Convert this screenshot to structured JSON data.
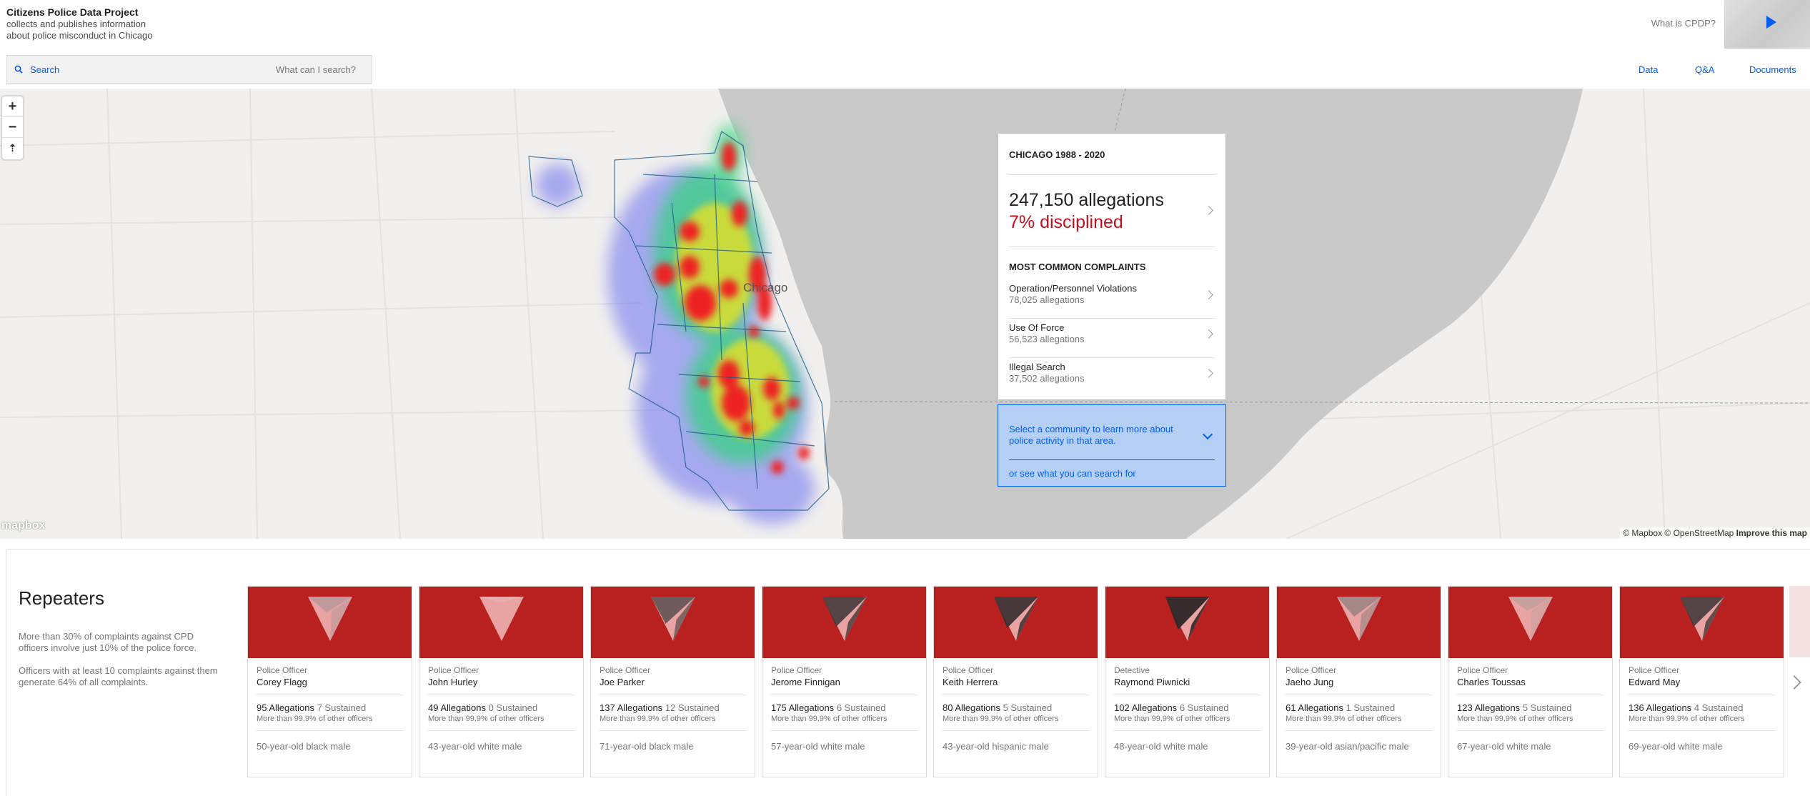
{
  "header": {
    "title": "Citizens Police Data Project",
    "subtitle_line1": "collects and publishes information",
    "subtitle_line2": "about police misconduct in Chicago",
    "what_is": "What is CPDP?",
    "search_label": "Search",
    "search_hint": "What can I search?",
    "nav": [
      "Data",
      "Q&A",
      "Documents"
    ]
  },
  "map": {
    "city_label": "Chicago",
    "zoom_in": "+",
    "zoom_out": "−",
    "compass": "⇡",
    "logo": "mapbox",
    "attribution": "© Mapbox © OpenStreetMap",
    "attribution_link": "Improve this map"
  },
  "summary": {
    "title": "CHICAGO 1988 - 2020",
    "allegations": "247,150 allegations",
    "disciplined": "7% disciplined",
    "common_title": "MOST COMMON COMPLAINTS",
    "complaints": [
      {
        "name": "Operation/Personnel Violations",
        "count": "78,025 allegations"
      },
      {
        "name": "Use Of Force",
        "count": "56,523 allegations"
      },
      {
        "name": "Illegal Search",
        "count": "37,502 allegations"
      }
    ]
  },
  "community": {
    "text": "Select a community to learn more about police activity in that area.",
    "link_prefix": "or ",
    "link": "see what you can search for"
  },
  "repeaters": {
    "title": "Repeaters",
    "desc1": "More than 30% of complaints against CPD officers involve just 10% of the police force.",
    "desc2": "Officers with at least 10 complaints against them generate 64% of all complaints.",
    "cards": [
      {
        "rank": "Police Officer",
        "name": "Corey Flagg",
        "allegations": "95 Allegations",
        "sustained": "7 Sustained",
        "pct": "More than 99.9% of other officers",
        "demo": "50-year-old black male",
        "shade": 0.35
      },
      {
        "rank": "Police Officer",
        "name": "John Hurley",
        "allegations": "49 Allegations",
        "sustained": "0 Sustained",
        "pct": "More than 99.9% of other officers",
        "demo": "43-year-old white male",
        "shade": 0.0
      },
      {
        "rank": "Police Officer",
        "name": "Joe Parker",
        "allegations": "137 Allegations",
        "sustained": "12 Sustained",
        "pct": "More than 99.9% of other officers",
        "demo": "71-year-old black male",
        "shade": 0.75
      },
      {
        "rank": "Police Officer",
        "name": "Jerome Finnigan",
        "allegations": "175 Allegations",
        "sustained": "6 Sustained",
        "pct": "More than 99.9% of other officers",
        "demo": "57-year-old white male",
        "shade": 0.85
      },
      {
        "rank": "Police Officer",
        "name": "Keith Herrera",
        "allegations": "80 Allegations",
        "sustained": "5 Sustained",
        "pct": "More than 99.9% of other officers",
        "demo": "43-year-old hispanic male",
        "shade": 0.9
      },
      {
        "rank": "Detective",
        "name": "Raymond Piwnicki",
        "allegations": "102 Allegations",
        "sustained": "6 Sustained",
        "pct": "More than 99.9% of other officers",
        "demo": "48-year-old white male",
        "shade": 0.95
      },
      {
        "rank": "Police Officer",
        "name": "Jaeho Jung",
        "allegations": "61 Allegations",
        "sustained": "1 Sustained",
        "pct": "More than 99.9% of other officers",
        "demo": "39-year-old asian/pacific male",
        "shade": 0.5
      },
      {
        "rank": "Police Officer",
        "name": "Charles Toussas",
        "allegations": "123 Allegations",
        "sustained": "5 Sustained",
        "pct": "More than 99.9% of other officers",
        "demo": "67-year-old white male",
        "shade": 0.3
      },
      {
        "rank": "Police Officer",
        "name": "Edward May",
        "allegations": "136 Allegations",
        "sustained": "4 Sustained",
        "pct": "More than 99.9% of other officers",
        "demo": "69-year-old white male",
        "shade": 0.85
      }
    ]
  },
  "colors": {
    "accent": "#005ef4",
    "alert_red": "#c0121e",
    "card_red": "#b8211f",
    "water": "#c9c9c9",
    "land": "#f1f0ee"
  }
}
